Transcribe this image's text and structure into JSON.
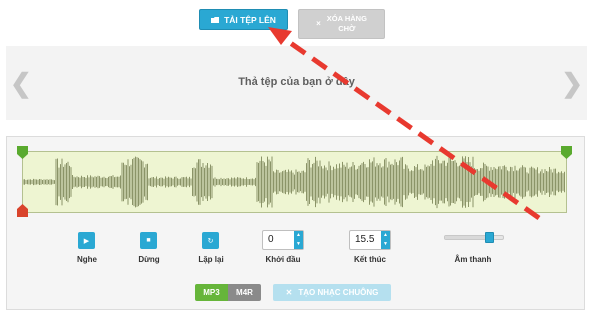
{
  "toolbar": {
    "upload_label": "TẢI TỆP LÊN",
    "clear_label_line1": "XÓA HÀNG",
    "clear_label_line2": "CHỜ",
    "upload_icon": "folder-icon",
    "clear_icon": "close-icon"
  },
  "dropzone": {
    "text": "Thả tệp của bạn ở đây",
    "prev_glyph": "❮",
    "next_glyph": "❯"
  },
  "player": {
    "play_label": "Nghe",
    "stop_label": "Dừng",
    "loop_label": "Lặp lại",
    "start_label": "Khởi đầu",
    "start_value": "0",
    "end_label": "Kết thúc",
    "end_value": "15.5",
    "volume_label": "Âm thanh",
    "volume_level": 0.78
  },
  "output": {
    "format_mp3": "MP3",
    "format_m4r": "M4R",
    "selected_format": "MP3",
    "make_label": "TẠO NHẠC CHUÔNG"
  },
  "colors": {
    "accent": "#2aa8d3",
    "waveform_bg": "#eef5d2",
    "waveform": "#8b9468",
    "marker_start": "#5aaa2e",
    "marker_end": "#d9442b",
    "arrow": "#e8392f"
  }
}
